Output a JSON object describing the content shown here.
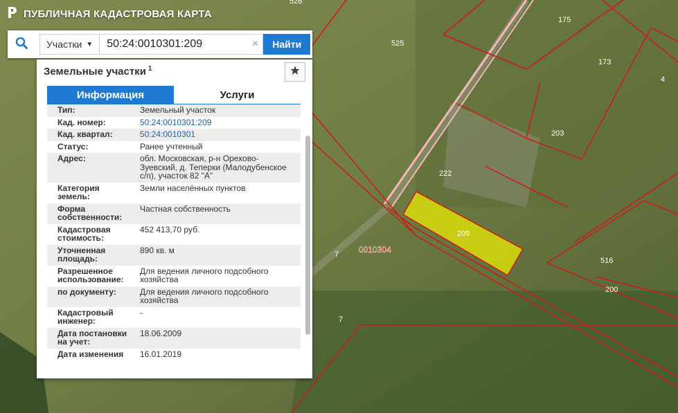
{
  "app": {
    "title": "ПУБЛИЧНАЯ КАДАСТРОВАЯ КАРТА",
    "logo_icon": "pkk-logo-icon"
  },
  "search": {
    "icon": "search-icon",
    "type_label": "Участки",
    "query": "50:24:0010301:209",
    "clear_label": "×",
    "find_label": "Найти"
  },
  "panel": {
    "title": "Земельные участки",
    "count": "1",
    "favorite_icon": "star-icon",
    "tabs": [
      {
        "label": "Информация",
        "active": true
      },
      {
        "label": "Услуги",
        "active": false
      }
    ],
    "rows": [
      {
        "label": "Тип:",
        "value": "Земельный участок"
      },
      {
        "label": "Кад. номер:",
        "value": "50:24:0010301:209",
        "link": true
      },
      {
        "label": "Кад. квартал:",
        "value": "50:24:0010301",
        "link": true
      },
      {
        "label": "Статус:",
        "value": "Ранее учтенный"
      },
      {
        "label": "Адрес:",
        "value": "обл. Московская, р-н Орехово-Зуевский, д. Теперки (Малодубенское с/п), участок 82 \"А\""
      },
      {
        "label": "Категория земель:",
        "value": "Земли населённых пунктов"
      },
      {
        "label": "Форма собственности:",
        "value": "Частная собственность"
      },
      {
        "label": "Кадастровая стоимость:",
        "value": "452 413,70 руб."
      },
      {
        "label": "Уточненная площадь:",
        "value": "890 кв. м"
      },
      {
        "label": "Разрешенное использование:",
        "value": "Для ведения личного подсобного хозяйства"
      },
      {
        "label": "по документу:",
        "value": "Для ведения личного подсобного хозяйства"
      },
      {
        "label": "Кадастровый инженер:",
        "value": "-"
      },
      {
        "label": "Дата постановки на учет:",
        "value": "18.06.2009"
      },
      {
        "label": "Дата изменения",
        "value": "16.01.2019"
      }
    ]
  },
  "map": {
    "quarter_label": "0010304",
    "parcel_labels": [
      "526",
      "525",
      "175",
      "173",
      "4",
      "203",
      "222",
      "209",
      "516",
      "200",
      "7",
      "7"
    ],
    "colors": {
      "boundary": "#d01a1a",
      "selected_fill": "#f2f200",
      "road": "#f7b7b7"
    }
  }
}
